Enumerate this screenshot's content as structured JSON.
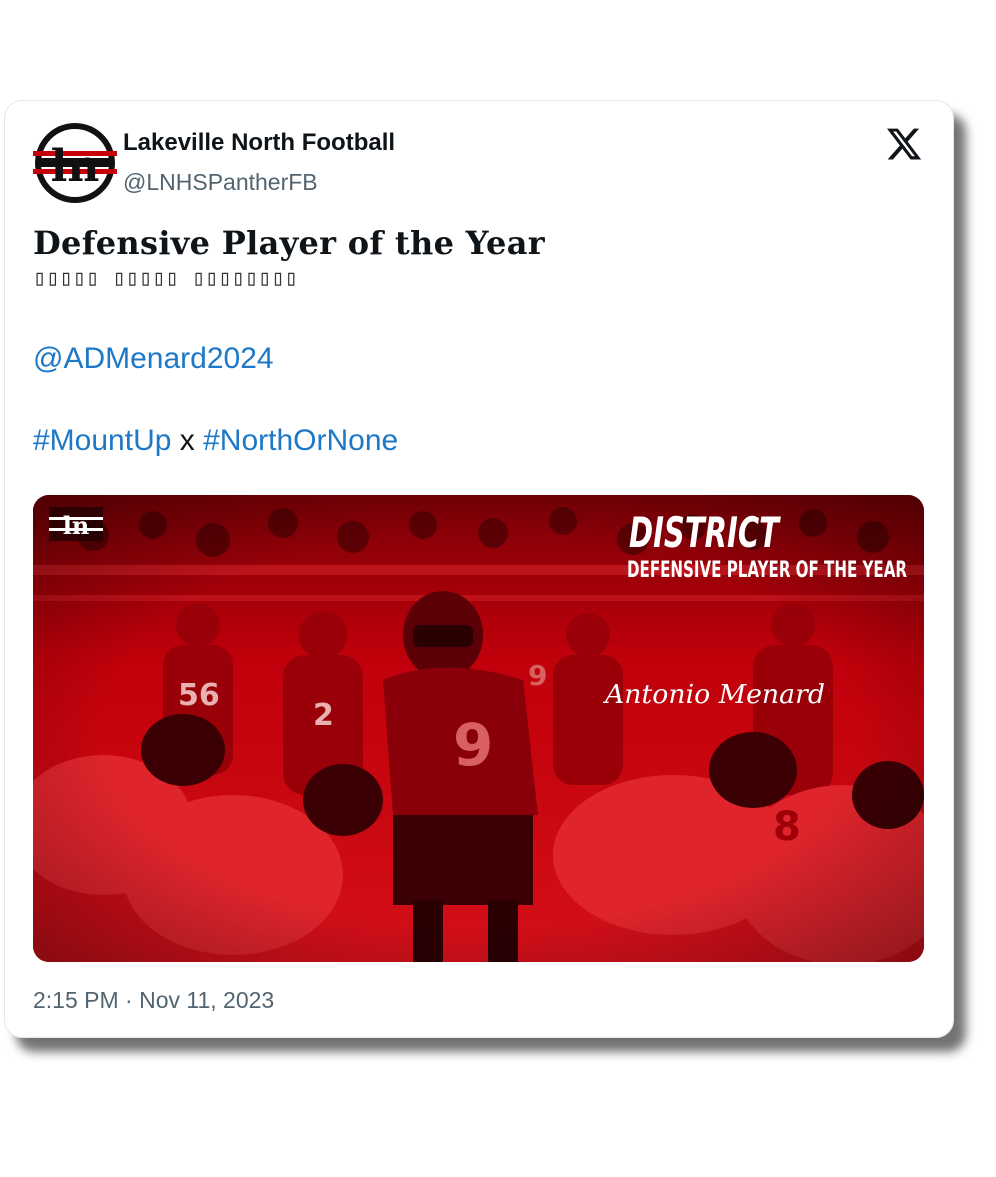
{
  "author": {
    "display_name": "Lakeville North Football",
    "handle": "@LNHSPantherFB",
    "avatar_monogram": "ln"
  },
  "icons": {
    "platform_logo": "x-logo-icon",
    "avatar": "lakeville-north-monogram-logo"
  },
  "tweet": {
    "headline": "Defensive Player of the Year",
    "subline": "▯▯▯▯▯ ▯▯▯▯▯ ▯▯▯▯▯▯▯▯",
    "mention": "@ADMenard2024",
    "hashtag_1": "#MountUp",
    "hashtag_separator": "x",
    "hashtag_2": "#NorthOrNone"
  },
  "media": {
    "badge": "ln",
    "title_line_1": "DISTRICT",
    "title_line_2": "DEFENSIVE PLAYER OF THE YEAR",
    "player_name": "Antonio Menard",
    "jersey_numbers": [
      "9",
      "9",
      "56",
      "2",
      "8"
    ]
  },
  "timestamp": "2:15 PM · Nov 11, 2023",
  "colors": {
    "link": "#1d78c7",
    "text": "#0f1419",
    "muted": "#536471",
    "media_red": "#c8000a"
  }
}
